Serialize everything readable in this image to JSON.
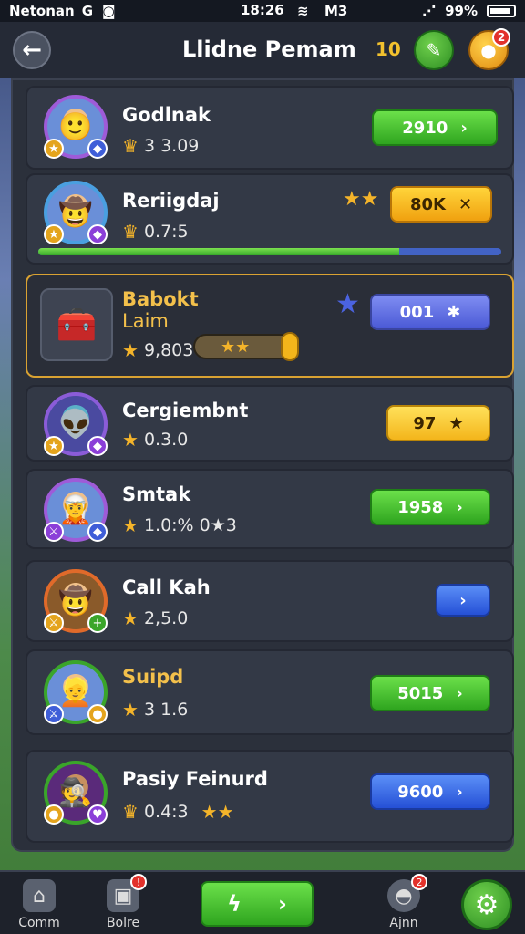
{
  "status_bar": {
    "carrier": "Netonan",
    "carrier_extra": "G",
    "time": "18:26",
    "network": "M3",
    "battery": "99%"
  },
  "header": {
    "title": "Llidne Pemam",
    "count": "10",
    "notif_badge": "2"
  },
  "rows": [
    {
      "name": "Godlnak",
      "stat": "3 3.09",
      "button": "2910",
      "color": "green",
      "stars": ""
    },
    {
      "name": "Reriigdaj",
      "stat": "0.7:5",
      "button": "80K",
      "color": "orange",
      "stars": "★★",
      "progress": 0.78
    },
    {
      "name": "Babokt",
      "subname": "Laim",
      "stat": "9,803",
      "button": "001",
      "color": "purple",
      "highlight": true
    },
    {
      "name": "Cergiembnt",
      "stat": "0.3.0",
      "button": "97",
      "color": "yellow"
    },
    {
      "name": "Smtak",
      "stat": "1.0:% 0★3",
      "button": "1958",
      "color": "green"
    },
    {
      "name": "Call Kah",
      "stat": "2,5.0",
      "button": "",
      "color": "blue"
    },
    {
      "name": "Suipd",
      "stat": "3 1.6",
      "button": "5015",
      "color": "green"
    },
    {
      "name": "Pasiy Feinurd",
      "stat": "0.4:3",
      "button": "9600",
      "color": "blue",
      "stars": "★★"
    }
  ],
  "bottom_nav": {
    "tab1": "Comm",
    "tab2": "Bolre",
    "tab2_badge": "!",
    "tab3": "Ajnn",
    "tab3_badge": "2"
  },
  "icons": {
    "back": "arrow-left-icon",
    "settings": "gear-icon",
    "coin": "coin-icon"
  }
}
